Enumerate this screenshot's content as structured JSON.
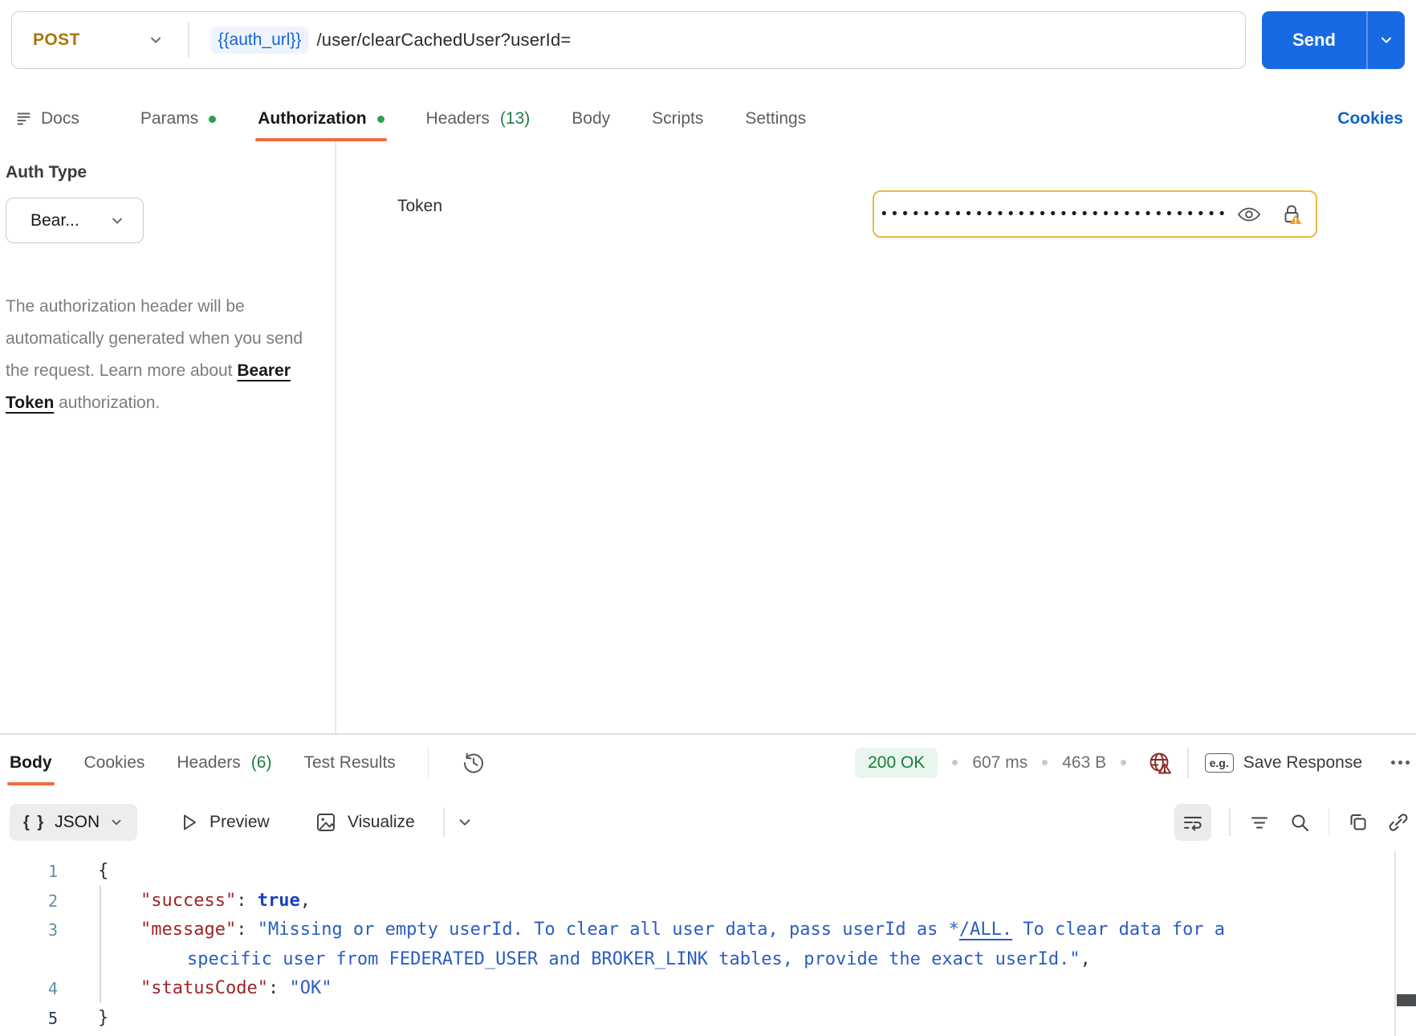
{
  "request": {
    "method": "POST",
    "url_variable": "{{auth_url}}",
    "url_path": "/user/clearCachedUser?userId=",
    "send_label": "Send"
  },
  "tabs": {
    "items": [
      {
        "label": "Docs"
      },
      {
        "label": "Params",
        "modified": true
      },
      {
        "label": "Authorization",
        "modified": true,
        "active": true
      },
      {
        "label": "Headers",
        "count": "(13)"
      },
      {
        "label": "Body"
      },
      {
        "label": "Scripts"
      },
      {
        "label": "Settings"
      }
    ],
    "cookies_link": "Cookies"
  },
  "auth": {
    "type_label": "Auth Type",
    "type_value": "Bear...",
    "description_1": "The authorization header will be automatically generated when you send the request. Learn more about ",
    "description_link": "Bearer Token",
    "description_2": " authorization.",
    "token_label": "Token",
    "token_masked": "•••••••••••••••••••••••••••••••••"
  },
  "response": {
    "tabs": {
      "body": "Body",
      "cookies": "Cookies",
      "headers": "Headers",
      "headers_count": "(6)",
      "tests": "Test Results"
    },
    "status": "200 OK",
    "time": "607 ms",
    "size": "463 B",
    "eg_label": "e.g.",
    "save_label": "Save Response",
    "viewer": {
      "braces": "{ }",
      "format": "JSON",
      "preview": "Preview",
      "visualize": "Visualize"
    },
    "code_lines": [
      {
        "num": "1",
        "indent": 0,
        "segments": [
          {
            "text": "{",
            "type": "brace"
          }
        ]
      },
      {
        "num": "2",
        "indent": 1,
        "segments": [
          {
            "text": "\"success\"",
            "type": "key"
          },
          {
            "text": ": ",
            "type": "punct"
          },
          {
            "text": "true",
            "type": "bool"
          },
          {
            "text": ",",
            "type": "punct"
          }
        ]
      },
      {
        "num": "3",
        "indent": 1,
        "segments": [
          {
            "text": "\"message\"",
            "type": "key"
          },
          {
            "text": ": ",
            "type": "punct"
          },
          {
            "text": "\"Missing or empty userId. To clear all user data, pass userId as *",
            "type": "string"
          },
          {
            "text": "/ALL.",
            "type": "string-link"
          },
          {
            "text": " To clear data for a",
            "type": "string"
          }
        ]
      },
      {
        "num": "",
        "indent": 2,
        "segments": [
          {
            "text": "specific user from FEDERATED_USER and BROKER_LINK tables, provide the exact userId.\"",
            "type": "string"
          },
          {
            "text": ",",
            "type": "punct"
          }
        ]
      },
      {
        "num": "4",
        "indent": 1,
        "segments": [
          {
            "text": "\"statusCode\"",
            "type": "key"
          },
          {
            "text": ": ",
            "type": "punct"
          },
          {
            "text": "\"OK\"",
            "type": "string"
          }
        ]
      },
      {
        "num": "5",
        "indent": 0,
        "current": true,
        "segments": [
          {
            "text": "}",
            "type": "brace"
          }
        ]
      }
    ]
  },
  "colors": {
    "method_post": "#A9760B",
    "accent_orange": "#F06A3B",
    "send_blue": "#176AE3",
    "link_blue": "#0D62D1",
    "variable_blue": "#1467D6",
    "modified_green": "#2E9E4F",
    "count_green": "#1D7D3F",
    "status_green": "#187C3D",
    "status_bg": "#E9F6ED",
    "token_warning_border": "#E7BB41",
    "lock_warning_orange": "#EF9E30",
    "globe_error_red": "#8B2A23",
    "code_key": "#9E2428",
    "code_string": "#2A5DC2",
    "code_bool": "#1C3FBE",
    "line_number": "#5E8FA3"
  }
}
